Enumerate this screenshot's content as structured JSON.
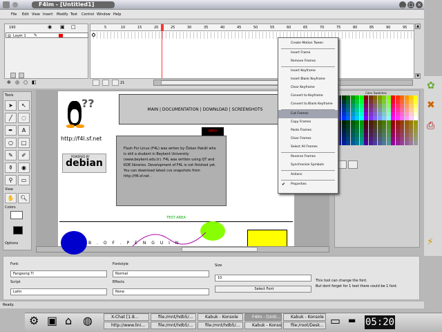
{
  "window": {
    "title": "F4lm - [Untitled1]"
  },
  "menu": [
    "File",
    "Edit",
    "View",
    "Insert",
    "Modify",
    "Text",
    "Control",
    "Window",
    "Help"
  ],
  "timeline": {
    "fps": "190",
    "layer_name": "Layer 1",
    "ruler": [
      "5",
      "10",
      "15",
      "20",
      "25",
      "30",
      "35",
      "40",
      "45",
      "50",
      "55",
      "60",
      "65",
      "70",
      "75",
      "80",
      "85",
      "90",
      "95"
    ],
    "frame_counter": "21"
  },
  "tools": {
    "title": "Tools",
    "view_label": "View",
    "colors_label": "Colors",
    "options_label": "Options"
  },
  "stage": {
    "nav_text": "MAIN | DOCUMENTATION | DOWNLOAD | SCREENSHOTS",
    "info_label": "INFO",
    "url": "http://f4l.sf.net",
    "debian_badge": "debian",
    "powered_by": "POWERED BY",
    "body_text": "Flash For Linux (F4L) was writen by Özkan Pakdil who is still a student in Beykent University (www.beykent.edu.tr). F4L was written using QT and KDE libraries. Development of F4L is not finished yet. You can download latest cvs snapshots from http://f4l.sf.net .",
    "test_area": "TEST AREA",
    "penguin_text": "B . O F . P E N G U I N"
  },
  "color_panel": {
    "title": "Color Swatches"
  },
  "context_menu": [
    "Create Motion Tween",
    "Insert Frame",
    "Remove Frames",
    "Insert Keyframe",
    "Insert Blank Keyframe",
    "Clear Keyframe",
    "Convert to Keyframe",
    "Convert to Blank Keyframe",
    "Cut Frames",
    "Copy Frames",
    "Paste Frames",
    "Clear Frames",
    "Select All Frames",
    "Reverse Frames",
    "Synchronize Symbols",
    "Actions",
    "Properties"
  ],
  "properties": {
    "font_label": "Font:",
    "font_value": "Fangsong Ti",
    "fontstyle_label": "Fontstyle",
    "fontstyle_value": "Normal",
    "size_label": "Size",
    "size_value": "10",
    "script_label": "Script",
    "script_value": "Latin",
    "effects_label": "Effects",
    "effects_value": "None",
    "select_font": "Select Font",
    "hint1": "This tool can change the font.",
    "hint2": "But dont forget for 1 text there could be 1 font."
  },
  "status": "Ready.",
  "taskbar": {
    "items": [
      "X-Chat [1.8...",
      "file:/mnt/hdb5/...",
      "Kabuk - Konsole",
      "F4lm - [Unti...",
      "Kabuk - Konsole",
      "http://www.lini...",
      "file:/mnt/hdb5/...",
      "file:/mnt/hdb5/...",
      "Kabuk - Konsole",
      "file:/root/Desk..."
    ],
    "clock": "05:20"
  }
}
